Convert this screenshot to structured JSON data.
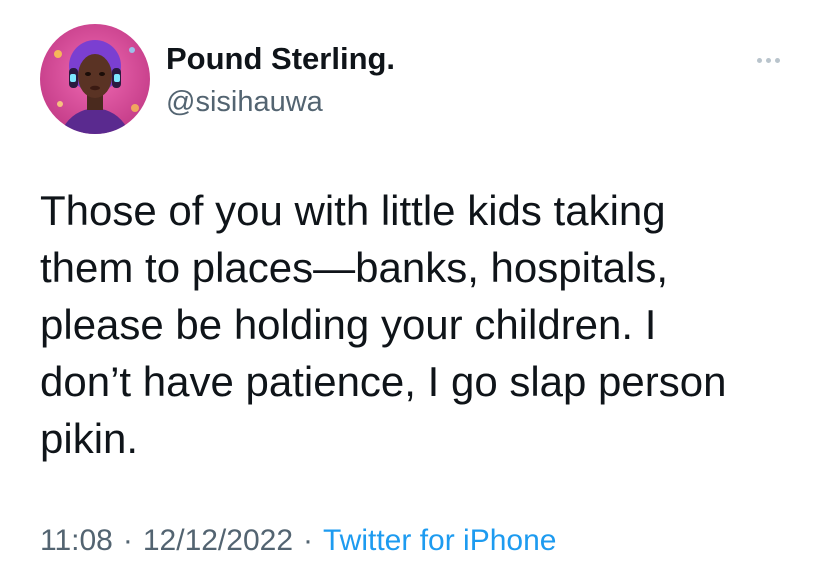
{
  "author": {
    "display_name": "Pound Sterling.",
    "handle": "@sisihauwa"
  },
  "more_icon": "more-horizontal-icon",
  "tweet": {
    "lines": [
      "Those of you with little kids taking",
      "them to places—banks, hospitals,",
      "please be holding your children. I",
      "don’t have patience, I go slap person",
      "pikin."
    ]
  },
  "meta": {
    "time": "11:08",
    "separator": "·",
    "date": "12/12/2022",
    "source": "Twitter for iPhone"
  },
  "colors": {
    "text": "#0f1419",
    "secondary": "#536471",
    "link": "#1d9bf0",
    "avatar_bg": "#e0479a"
  }
}
